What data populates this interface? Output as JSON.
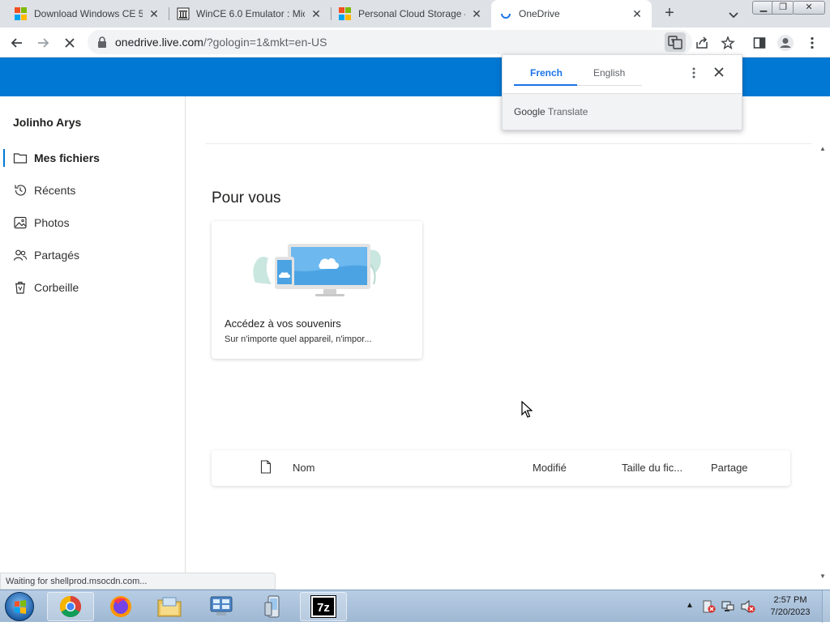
{
  "browser": {
    "tabs": [
      {
        "title": "Download Windows CE 5",
        "icon": "microsoft-logo-icon",
        "active": false
      },
      {
        "title": "WinCE 6.0 Emulator : Mic",
        "icon": "archive-building-icon",
        "active": false
      },
      {
        "title": "Personal Cloud Storage –",
        "icon": "microsoft-logo-icon",
        "active": false
      },
      {
        "title": "OneDrive",
        "icon": "loading-spinner-icon",
        "active": true
      }
    ],
    "new_tab_label": "+",
    "address": {
      "host": "onedrive.live.com",
      "path": "/?gologin=1&mkt=en-US"
    },
    "status_text": "Waiting for shellprod.msocdn.com..."
  },
  "translate_popup": {
    "source_lang": "French",
    "target_lang": "English",
    "brand_google": "Google",
    "brand_translate": "Translate"
  },
  "onedrive": {
    "accent_color": "#0078d4",
    "user_name": "Jolinho Arys",
    "nav": [
      {
        "label": "Mes fichiers",
        "icon": "folder-icon",
        "selected": true
      },
      {
        "label": "Récents",
        "icon": "history-icon",
        "selected": false
      },
      {
        "label": "Photos",
        "icon": "photo-icon",
        "selected": false
      },
      {
        "label": "Partagés",
        "icon": "people-icon",
        "selected": false
      },
      {
        "label": "Corbeille",
        "icon": "recycle-bin-icon",
        "selected": false
      }
    ],
    "section_title": "Pour vous",
    "card": {
      "title": "Accédez à vos souvenirs",
      "subtitle": "Sur n'importe quel appareil, n'impor..."
    },
    "file_columns": [
      "Nom",
      "Modifié",
      "Taille du fic...",
      "Partage"
    ]
  },
  "taskbar": {
    "apps": [
      "chrome-icon",
      "firefox-icon",
      "file-explorer-icon",
      "control-panel-icon",
      "device-emulator-icon",
      "7zip-icon"
    ],
    "clock_time": "2:57 PM",
    "clock_date": "7/20/2023",
    "sevenzip_label": "7z"
  }
}
